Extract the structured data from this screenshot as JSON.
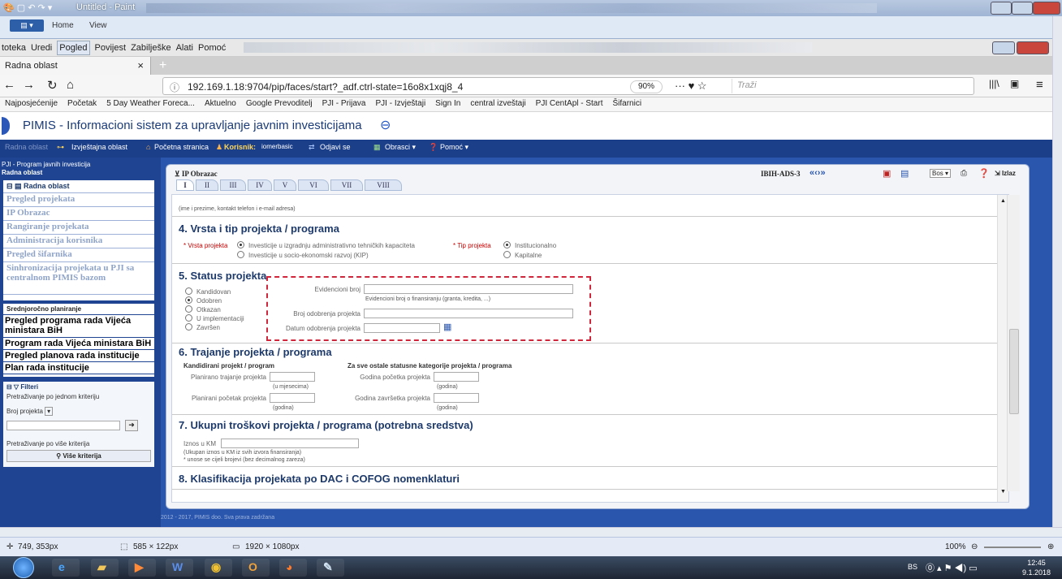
{
  "paint": {
    "title": "Untitled - Paint",
    "ribbon_tabs": [
      "Home",
      "View"
    ],
    "status_cursor": "749, 353px",
    "status_selection": "585 × 122px",
    "status_size": "1920 × 1080px",
    "zoom": "100%"
  },
  "firefox": {
    "menu": [
      "toteka",
      "Uredi",
      "Pogled",
      "Povijest",
      "Zabilješke",
      "Alati",
      "Pomoć"
    ],
    "tab_title": "Radna oblast",
    "url": "192.169.1.18:9704/pip/faces/start?_adf.ctrl-state=16o8x1xqj8_4",
    "zoom": "90%",
    "search_placeholder": "Traži",
    "bookmarks": [
      "Najposjećenije",
      "Početak",
      "5 Day Weather Foreca...",
      "Aktuelno",
      "Google Prevoditelj",
      "PJI - Prijava",
      "PJI - Izvještaji",
      "Sign In",
      "central izveštaji",
      "PJI CentApl - Start",
      "Šifarnici"
    ]
  },
  "app": {
    "title": "PIMIS - Informacioni sistem za upravljanje javnim investicijama",
    "nav": {
      "radna": "Radna oblast",
      "izvjestajna": "Izvještajna oblast",
      "pocetna": "Početna stranica",
      "korisnik_label": "Korisnik:",
      "korisnik_name": "iomerbasic",
      "odjavi": "Odjavi se",
      "obrasci": "Obrasci ▾",
      "pomoc": "Pomoć ▾"
    },
    "sidebar": {
      "breadcrumb1": "PJI - Program javnih investicija",
      "breadcrumb2": "Radna oblast",
      "group1": "Radna oblast",
      "links": [
        "Pregled projekata",
        "IP Obrazac",
        "Rangiranje projekata",
        "Administracija korisnika",
        "Pregled šifarnika",
        "Sinhronizacija projekata u PJI sa centralnom PIMIS bazom"
      ],
      "group2": "Srednjoročno planiranje",
      "bold_links": [
        "Pregled programa rada Vijeća ministara BiH",
        "Program rada Vijeća ministara BiH",
        "Pregled planova rada institucije",
        "Plan rada institucije"
      ],
      "filter_title": "Filteri",
      "filter_one": "Pretraživanje po jednom kriteriju",
      "filter_select": "Broj projekta",
      "filter_multi": "Pretraživanje po više kriterija",
      "more_button": "Više kriterija"
    },
    "form": {
      "panel_title": "IP Obrazac",
      "code": "IBIH-ADS-3",
      "lang_select": "Bos",
      "exit": "Izlaz",
      "tabs": [
        "I",
        "II",
        "III",
        "IV",
        "V",
        "VI",
        "VII",
        "VIII"
      ],
      "contact_hint": "(ime i prezime, kontakt telefon i e-mail adresa)",
      "s4_title": "4. Vrsta i tip projekta / programa",
      "s4_vrsta_label": "* Vrsta projekta",
      "s4_vrsta_opts": [
        "Investicije u izgradnju administrativno tehničkih kapaciteta",
        "Investicije u socio-ekonomski razvoj (KIP)"
      ],
      "s4_tip_label": "* Tip projekta",
      "s4_tip_opts": [
        "Institucionalno",
        "Kapitalne"
      ],
      "s5_title": "5. Status projekta",
      "s5_status": [
        "Kandidovan",
        "Odobren",
        "Otkazan",
        "U implementaciji",
        "Završen"
      ],
      "s5_evid": "Evidencioni broj",
      "s5_evid_hint": "Evidencioni broj o finansiranju (granta, kredita, ...)",
      "s5_broj": "Broj odobrenja projekta",
      "s5_datum": "Datum odobrenja projekta",
      "s6_title": "6. Trajanje projekta / programa",
      "s6_left": "Kandidirani projekt / program",
      "s6_right": "Za sve ostale statusne kategorije projekta / programa",
      "s6_plan_traj": "Planirano trajanje projekta",
      "s6_mj": "(u mjesecima)",
      "s6_plan_poc": "Planirani početak projekta",
      "s6_godina": "(godina)",
      "s6_god_poc": "Godina početka projekta",
      "s6_god_zav": "Godina završetka projekta",
      "s7_title": "7. Ukupni troškovi projekta / programa (potrebna sredstva)",
      "s7_iznos": "Iznos u KM",
      "s7_hint1": "(Ukupan iznos u KM iz svih izvora finansiranja)",
      "s7_hint2": "* unose se cijeli brojevi (bez decimalnog zareza)",
      "s8_title": "8. Klasifikacija projekata po DAC i COFOG nomenklaturi"
    },
    "footer": "2012 - 2017, PIMIS doo. Sva prava zadržana"
  },
  "taskbar": {
    "lang": "BS",
    "time": "12:45",
    "date": "9.1.2018"
  }
}
